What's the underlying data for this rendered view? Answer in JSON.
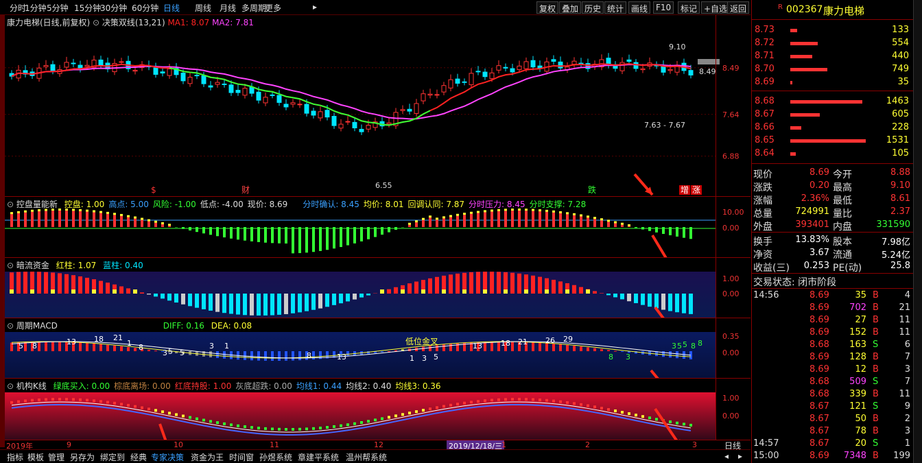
{
  "periods": [
    "分时",
    "1分钟",
    "5分钟",
    "15分钟",
    "30分钟",
    "60分钟",
    "日线",
    "周线",
    "月线",
    "多周期",
    "更多"
  ],
  "active_period": "日线",
  "right_buttons": [
    "复权",
    "叠加",
    "历史",
    "统计",
    "画线",
    "F10",
    "标记",
    "+自选",
    "返回"
  ],
  "main": {
    "title": "康力电梯(日线,前复权)",
    "indicator": "决策双线(13,21)",
    "ma1": "MA1: 8.07",
    "ma2": "MA2: 7.81",
    "price_labels": [
      "8.49",
      "7.64",
      "6.88"
    ],
    "high_mark": "9.10",
    "low_mark": "6.55",
    "ref_mark": "8.49",
    "range_mark": "7.63 - 7.67",
    "event_labels": [
      "$",
      "财",
      "跌",
      "增",
      "涨"
    ]
  },
  "pane2": {
    "name": "控盘量能新",
    "fields": [
      "控盘: 1.00",
      "高点: 5.00",
      "风险: -1.00",
      "低点: -4.00",
      "现价: 8.69",
      "分时确认: 8.45",
      "均价: 8.01",
      "回调认同: 7.87",
      "分时压力: 8.45",
      "分时支撑: 7.28"
    ],
    "axis": [
      "10.00",
      "0.00"
    ]
  },
  "pane3": {
    "name": "暗流资金",
    "fields": [
      "红柱: 1.07",
      "蓝柱: 0.40"
    ],
    "axis": [
      "1.00",
      "0.00"
    ]
  },
  "pane4": {
    "name": "周期MACD",
    "fields": [
      "DIFF: 0.16",
      "DEA: 0.08"
    ],
    "axis": [
      "0.35",
      "0.00"
    ],
    "note": "低位金叉",
    "numbers": [
      "5",
      "8",
      "13",
      "18",
      "21",
      "1",
      "5",
      "3",
      "1",
      "3",
      "5",
      "8",
      "8",
      "13",
      "1",
      "3",
      "5",
      "13",
      "18",
      "21",
      "26",
      "29",
      "3",
      "5",
      "8",
      "8",
      "3",
      "5",
      "8"
    ]
  },
  "pane5": {
    "name": "机构K线",
    "fields": [
      "绿底买入: 0.00",
      "棕底离场: 0.00",
      "红底持股: 1.00",
      "灰底超跌: 0.00",
      "均线1: 0.44",
      "均线2: 0.40",
      "均线3: 0.36"
    ],
    "axis": [
      "1.00",
      "0.00"
    ]
  },
  "dates": [
    "2019年",
    "9",
    "10",
    "11",
    "12",
    "2019/12/18/三",
    "1",
    "2",
    "3"
  ],
  "cycle_label": "日线",
  "bottom_tabs": [
    "指标",
    "模板",
    "管理",
    "另存为",
    "绑定到",
    "经典",
    "专家决策",
    "资金为王",
    "时间窗",
    "孙煜系统",
    "章建平系统",
    "温州帮系统"
  ],
  "active_tab": "专家决策",
  "quote": {
    "code": "002367",
    "name": "康力电梯",
    "flag": "R",
    "asks": [
      {
        "p": "8.73",
        "v": "133"
      },
      {
        "p": "8.72",
        "v": "554"
      },
      {
        "p": "8.71",
        "v": "440"
      },
      {
        "p": "8.70",
        "v": "749"
      },
      {
        "p": "8.69",
        "v": "35"
      }
    ],
    "bids": [
      {
        "p": "8.68",
        "v": "1463"
      },
      {
        "p": "8.67",
        "v": "605"
      },
      {
        "p": "8.66",
        "v": "228"
      },
      {
        "p": "8.65",
        "v": "1531"
      },
      {
        "p": "8.64",
        "v": "105"
      }
    ],
    "stats": [
      [
        "现价",
        "8.69",
        "今开",
        "8.88"
      ],
      [
        "涨跌",
        "0.20",
        "最高",
        "9.10"
      ],
      [
        "涨幅",
        "2.36%",
        "最低",
        "8.61"
      ],
      [
        "总量",
        "724991",
        "量比",
        "2.37"
      ],
      [
        "外盘",
        "393401",
        "内盘",
        "331590"
      ]
    ],
    "stats2": [
      [
        "换手",
        "13.83%",
        "股本",
        "7.98亿"
      ],
      [
        "净资",
        "3.67",
        "流通",
        "5.24亿"
      ],
      [
        "收益(三)",
        "0.253",
        "PE(动)",
        "25.8"
      ]
    ],
    "status": "交易状态: 闭市阶段",
    "ticks": [
      [
        "14:56",
        "8.69",
        "35",
        "B",
        "4"
      ],
      [
        "",
        "8.69",
        "702",
        "B",
        "21"
      ],
      [
        "",
        "8.69",
        "27",
        "B",
        "11"
      ],
      [
        "",
        "8.69",
        "152",
        "B",
        "11"
      ],
      [
        "",
        "8.68",
        "163",
        "S",
        "6"
      ],
      [
        "",
        "8.69",
        "128",
        "B",
        "7"
      ],
      [
        "",
        "8.69",
        "12",
        "B",
        "3"
      ],
      [
        "",
        "8.68",
        "509",
        "S",
        "7"
      ],
      [
        "",
        "8.68",
        "339",
        "B",
        "11"
      ],
      [
        "",
        "8.67",
        "121",
        "S",
        "9"
      ],
      [
        "",
        "8.67",
        "50",
        "B",
        "2"
      ],
      [
        "",
        "8.67",
        "78",
        "B",
        "3"
      ],
      [
        "14:57",
        "8.67",
        "20",
        "S",
        "1"
      ],
      [
        "15:00",
        "8.69",
        "7348",
        "B",
        "199"
      ]
    ]
  },
  "colors": {
    "up": "#ff3333",
    "down": "#00e5ff",
    "green": "#33ff33",
    "yellow": "#ffff33",
    "accent": "#3aa0ff",
    "ma1": "#ff2222",
    "ma2": "#ff44ff"
  }
}
